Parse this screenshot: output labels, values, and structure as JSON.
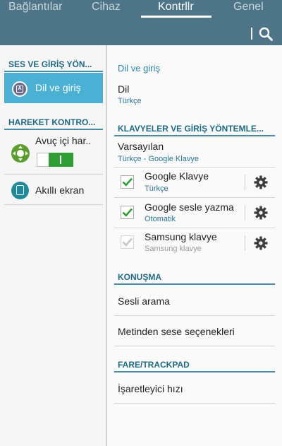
{
  "tabs": {
    "items": [
      {
        "label": "Bağlantılar"
      },
      {
        "label": "Cihaz"
      },
      {
        "label": "Kontrllr"
      },
      {
        "label": "Genel"
      }
    ],
    "active_index": 2
  },
  "toolbar": {
    "search_icon": "search-icon"
  },
  "colors": {
    "topbar": "#4d7587",
    "accent": "#1e6b86",
    "selected_item": "#4ab0d4",
    "toggle_on": "#2f9e34"
  },
  "left_panel": {
    "section1_header": "SES VE GİRİŞ YÖN...",
    "selected_item": {
      "label": "Dil ve giriş",
      "icon": "language-input-icon"
    },
    "section2_header": "HAREKET KONTRO...",
    "palm_item": {
      "label": "Avuç içi har..",
      "icon": "palm-motion-icon",
      "toggle_state": "on"
    },
    "smart_screen_item": {
      "label": "Akıllı ekran",
      "icon": "smart-screen-icon"
    }
  },
  "right_panel": {
    "breadcrumb": "Dil ve giriş",
    "language": {
      "title": "Dil",
      "value": "Türkçe"
    },
    "keyboards_header": "KLAVYELER VE GİRİŞ YÖNTEMLE...",
    "default": {
      "title": "Varsayılan",
      "value": "Türkçe - Google Klavye"
    },
    "keyboards": [
      {
        "title": "Google Klavye",
        "subtitle": "Türkçe",
        "checked": true,
        "enabled": true,
        "settings_icon": "gear-icon"
      },
      {
        "title": "Google sesle yazma",
        "subtitle": "Otomatik",
        "checked": true,
        "enabled": true,
        "settings_icon": "gear-icon"
      },
      {
        "title": "Samsung klavye",
        "subtitle": "Samsung klavye",
        "checked": true,
        "enabled": false,
        "settings_icon": "gear-icon"
      }
    ],
    "speech_header": "KONUŞMA",
    "voice_search": "Sesli arama",
    "tts": "Metinden sese seçenekleri",
    "mouse_header": "FARE/TRACKPAD",
    "pointer_speed": "İşaretleyici hızı"
  }
}
